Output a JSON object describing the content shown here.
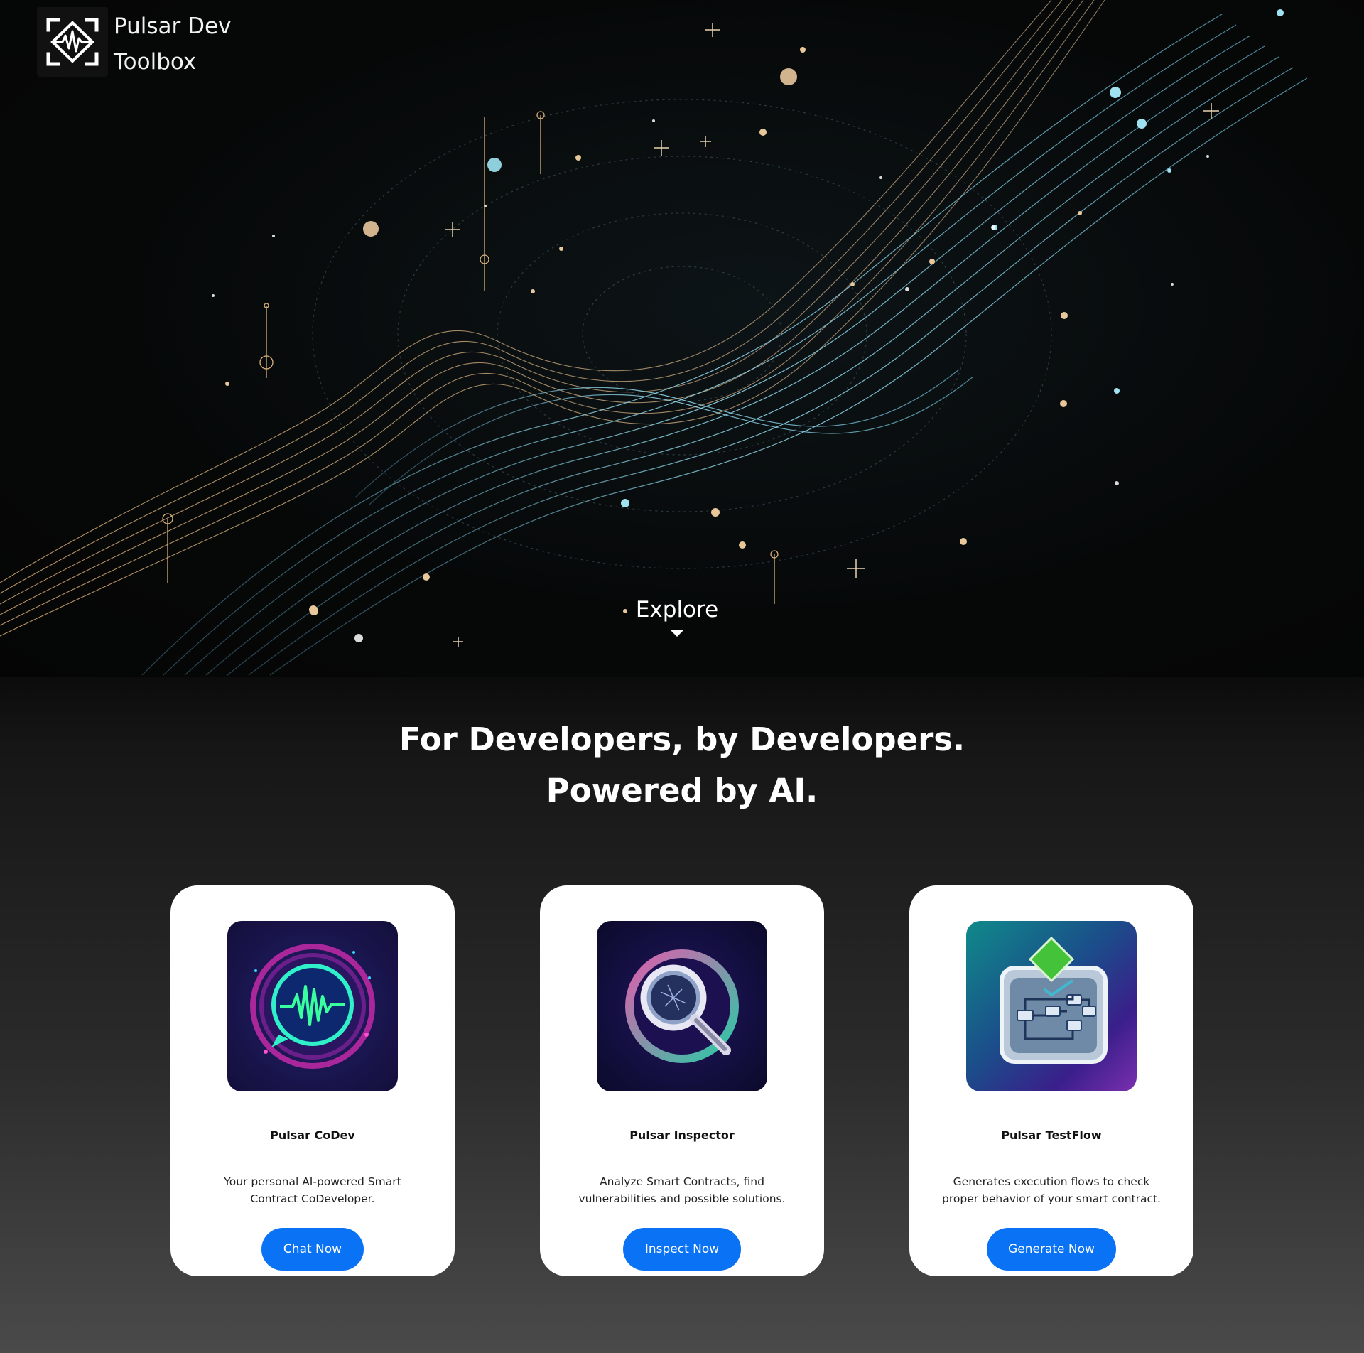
{
  "brand": {
    "name_line1": "Pulsar Dev",
    "name_line2": "Toolbox",
    "logo_icon": "pulse-diamond-icon"
  },
  "hero": {
    "explore_label": "Explore",
    "explore_icon": "caret-down-icon"
  },
  "headline": {
    "line1": "For Developers, by Developers.",
    "line2": "Powered by AI."
  },
  "cards": [
    {
      "title": "Pulsar CoDev",
      "description": "Your personal AI-powered Smart Contract CoDeveloper.",
      "button": "Chat Now",
      "icon": "chat-waveform-icon"
    },
    {
      "title": "Pulsar Inspector",
      "description": "Analyze Smart Contracts, find vulnerabilities and possible solutions.",
      "button": "Inspect Now",
      "icon": "magnifier-icon"
    },
    {
      "title": "Pulsar TestFlow",
      "description": "Generates execution flows to check proper behavior of your smart contract.",
      "button": "Generate Now",
      "icon": "flowchart-icon"
    }
  ],
  "colors": {
    "accent_button": "#0a72f5",
    "hero_gold": "#d9b07a",
    "hero_cyan": "#7fc8dc"
  }
}
